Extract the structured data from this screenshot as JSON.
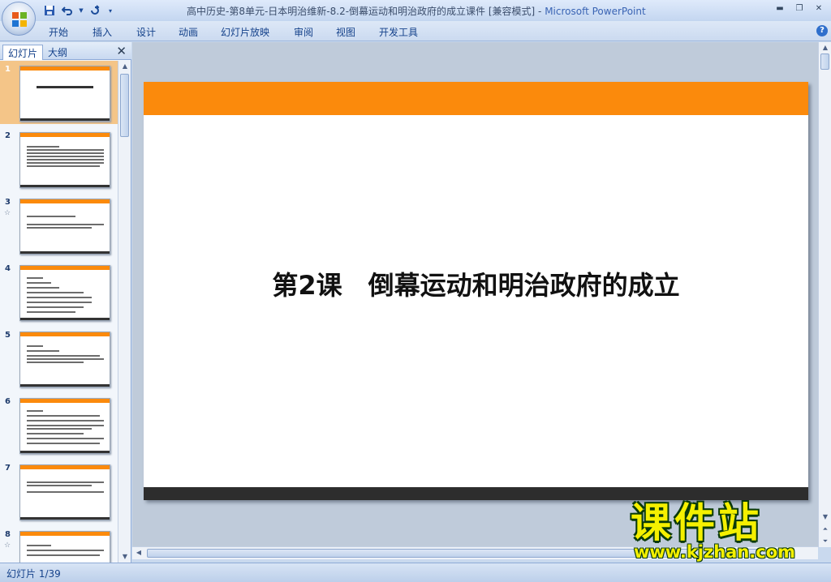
{
  "window": {
    "title": "高中历史-第8单元-日本明治维新-8.2-倒幕运动和明治政府的成立课件 [兼容模式] - ",
    "app_name": "Microsoft PowerPoint"
  },
  "quick_access": {
    "icons": [
      "save-icon",
      "undo-icon",
      "redo-icon",
      "customize-icon"
    ]
  },
  "menu": {
    "items": [
      "开始",
      "插入",
      "设计",
      "动画",
      "幻灯片放映",
      "审阅",
      "视图",
      "开发工具"
    ]
  },
  "left_panel": {
    "tabs": [
      "幻灯片",
      "大纲"
    ],
    "close": "✕"
  },
  "slides": [
    {
      "num": "1",
      "selected": true,
      "star": false
    },
    {
      "num": "2",
      "selected": false,
      "star": false
    },
    {
      "num": "3",
      "selected": false,
      "star": true
    },
    {
      "num": "4",
      "selected": false,
      "star": false
    },
    {
      "num": "5",
      "selected": false,
      "star": false
    },
    {
      "num": "6",
      "selected": false,
      "star": false
    },
    {
      "num": "7",
      "selected": false,
      "star": false
    },
    {
      "num": "8",
      "selected": false,
      "star": true
    }
  ],
  "current_slide": {
    "title": "第2课　倒幕运动和明治政府的成立"
  },
  "status": {
    "text": "幻灯片 1/39"
  },
  "watermark": {
    "cn": "课件站",
    "url": "www.kjzhan.com"
  },
  "colors": {
    "accent": "#fb8a0c",
    "slide_footer": "#2d2d2d"
  }
}
